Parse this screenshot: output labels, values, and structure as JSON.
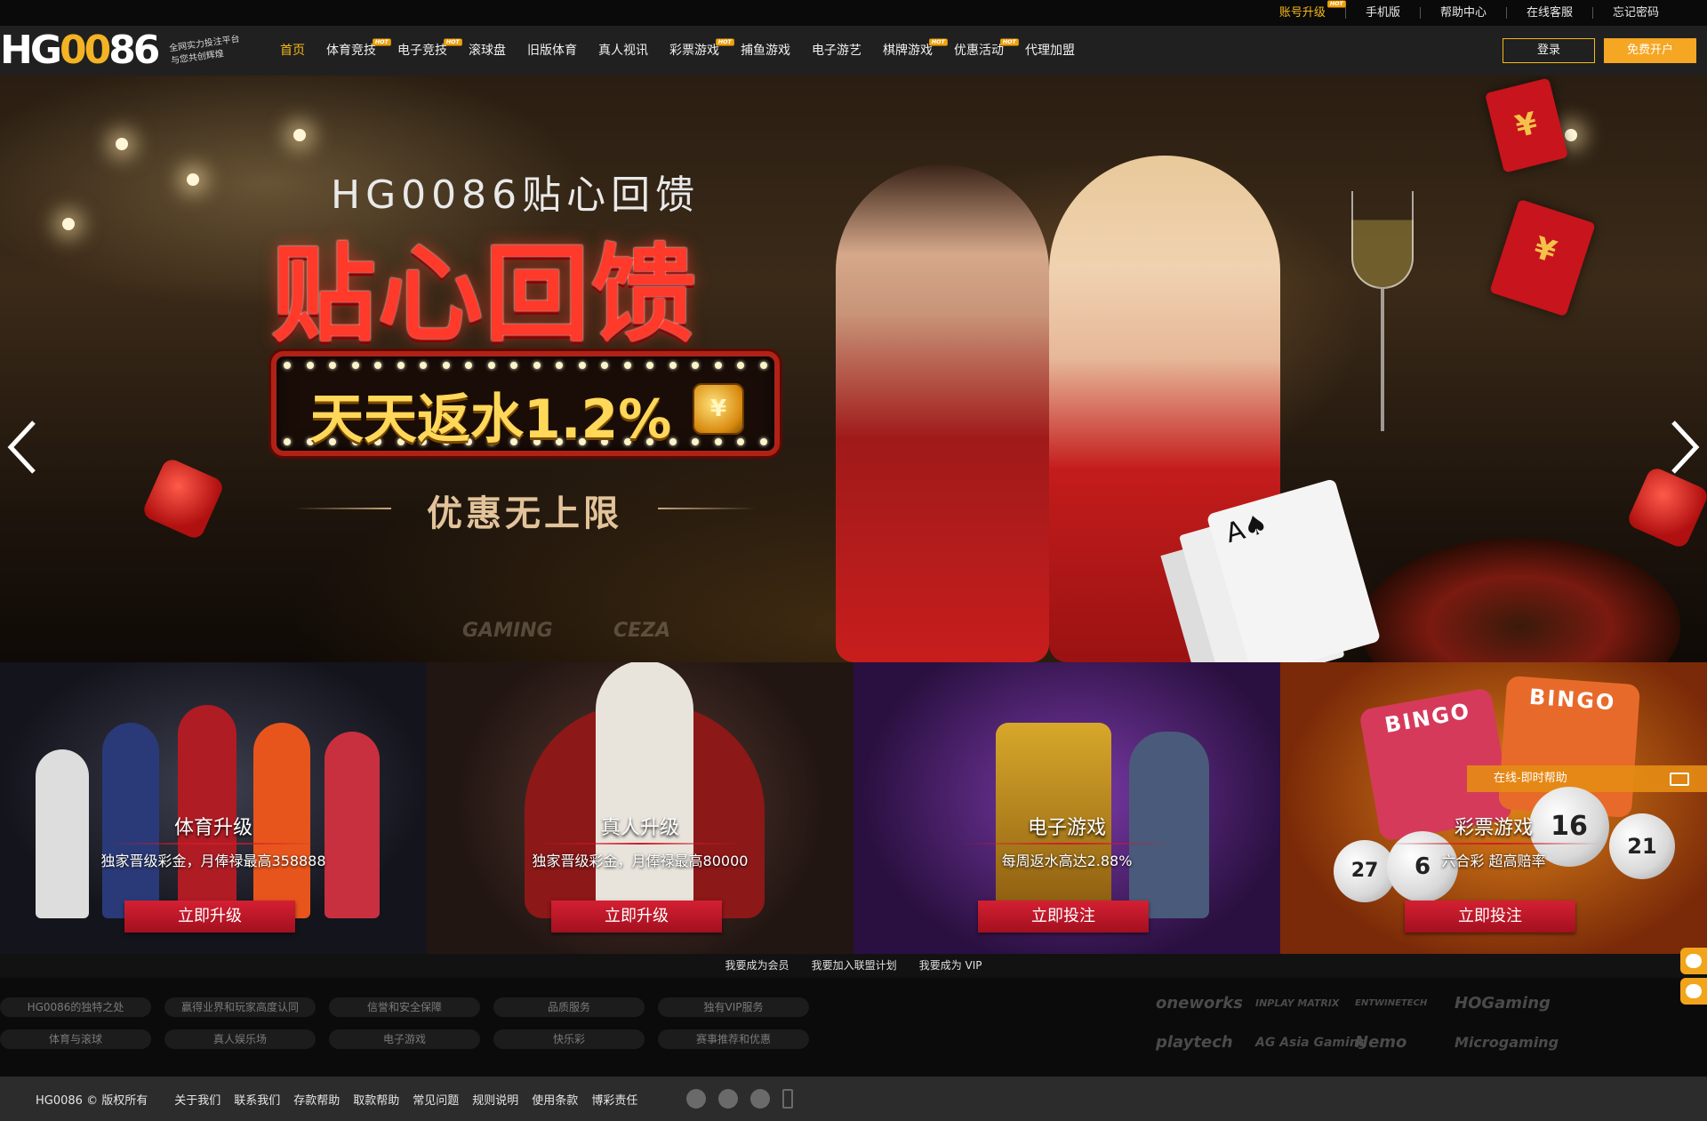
{
  "topbar": {
    "links": [
      {
        "label": "账号升级",
        "hot": "HOT",
        "highlight": true
      },
      {
        "label": "手机版"
      },
      {
        "label": "帮助中心"
      },
      {
        "label": "在线客服"
      },
      {
        "label": "忘记密码"
      }
    ]
  },
  "logo": {
    "text_white": "HG",
    "text_gold": "00",
    "text_white2": "86",
    "slogan_line1": "全网实力投注平台",
    "slogan_line2": "与您共创辉煌"
  },
  "nav": {
    "items": [
      {
        "label": "首页",
        "active": true
      },
      {
        "label": "体育竞技",
        "hot": "HOT"
      },
      {
        "label": "电子竞技",
        "hot": "HOT"
      },
      {
        "label": "滚球盘"
      },
      {
        "label": "旧版体育"
      },
      {
        "label": "真人视讯"
      },
      {
        "label": "彩票游戏",
        "hot": "HOT"
      },
      {
        "label": "捕鱼游戏"
      },
      {
        "label": "电子游艺"
      },
      {
        "label": "棋牌游戏",
        "hot": "HOT"
      },
      {
        "label": "优惠活动",
        "hot": "HOT"
      },
      {
        "label": "代理加盟"
      }
    ],
    "login_label": "登录",
    "register_label": "免费开户"
  },
  "banner": {
    "subtitle": "HG0086贴心回馈",
    "headline": "贴心回馈",
    "rebate_text": "天天返水1.2%",
    "coin_symbol": "¥",
    "tagline": "优惠无上限",
    "envelope_symbol": "¥",
    "cards_symbol": "A♠",
    "sponsors": [
      "GAMING",
      "CEZA",
      "playtech"
    ]
  },
  "tiles": [
    {
      "title": "体育升级",
      "desc": "独家晋级彩金，月俸禄最高358888",
      "button": "立即升级"
    },
    {
      "title": "真人升级",
      "desc": "独家晋级彩金，月俸禄最高80000",
      "button": "立即升级"
    },
    {
      "title": "电子游戏",
      "desc": "每周返水高达2.88%",
      "button": "立即投注"
    },
    {
      "title": "彩票游戏",
      "desc": "六合彩 超高赔率",
      "button": "立即投注",
      "help_label": "在线-即时帮助",
      "bingo_labels": [
        "BINGO",
        "BINGO"
      ],
      "ball_numbers": [
        "16",
        "21",
        "27",
        "6"
      ]
    }
  ],
  "strip": {
    "links": [
      "我要成为会员",
      "我要加入联盟计划",
      "我要成为 VIP"
    ]
  },
  "footer": {
    "pills": [
      "HG0086的独特之处",
      "赢得业界和玩家高度认同",
      "信誉和安全保障",
      "品质服务",
      "独有VIP服务",
      "体育与滚球",
      "真人娱乐场",
      "电子游戏",
      "快乐彩",
      "赛事推荐和优惠"
    ],
    "partners": [
      "oneworks",
      "INPLAY MATRIX",
      "ENTWINETECH",
      "HOGaming",
      "playtech",
      "AG Asia Gaming",
      "Nemo",
      "Microgaming"
    ]
  },
  "bottom": {
    "copyright": "HG0086 © 版权所有",
    "links": [
      "关于我们",
      "联系我们",
      "存款帮助",
      "取款帮助",
      "常见问题",
      "规则说明",
      "使用条款",
      "博彩责任"
    ]
  },
  "colors": {
    "accent_gold": "#f5b81a",
    "button_red": "#c41a2c",
    "nav_bg": "#202020"
  }
}
